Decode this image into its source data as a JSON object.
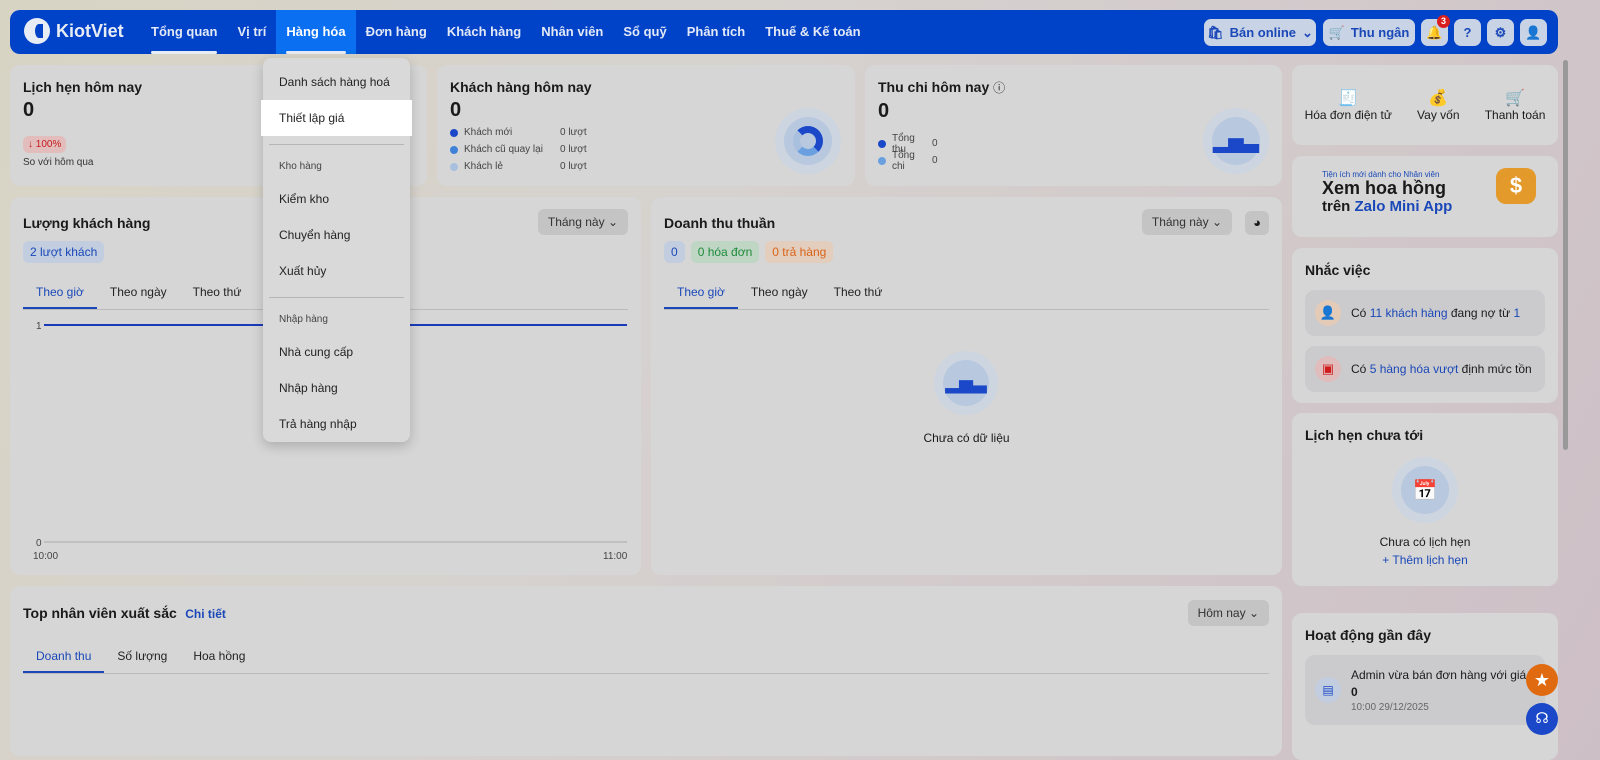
{
  "nav": {
    "brand": "KiotViet",
    "items": [
      "Tổng quan",
      "Vị trí",
      "Hàng hóa",
      "Đơn hàng",
      "Khách hàng",
      "Nhân viên",
      "Sổ quỹ",
      "Phân tích",
      "Thuế & Kế toán"
    ],
    "ban_online": "Bán online",
    "thu_ngan": "Thu ngân",
    "notif_count": "3"
  },
  "dropdown": {
    "items1": [
      "Danh sách hàng hoá",
      "Thiết lập giá"
    ],
    "group2": "Kho hàng",
    "items2": [
      "Kiểm kho",
      "Chuyển hàng",
      "Xuất hủy"
    ],
    "group3": "Nhập hàng",
    "items3": [
      "Nhà cung cấp",
      "Nhập hàng",
      "Trả hàng nhập"
    ]
  },
  "lich_hen": {
    "title": "Lịch hẹn hôm nay",
    "value": "0",
    "change": "↓ 100%",
    "compare": "So với hôm qua"
  },
  "khach_hang": {
    "title": "Khách hàng hôm nay",
    "value": "0",
    "legend": [
      {
        "label": "Khách mới",
        "value": "0 lượt",
        "color": "#1a48c8"
      },
      {
        "label": "Khách cũ quay lại",
        "value": "0 lượt",
        "color": "#3f82d8"
      },
      {
        "label": "Khách lẻ",
        "value": "0 lượt",
        "color": "#a8c0de"
      }
    ]
  },
  "thu_chi": {
    "title": "Thu chi hôm nay",
    "value": "0",
    "legend": [
      {
        "label": "Tổng thu",
        "value": "0",
        "color": "#1a48c8"
      },
      {
        "label": "Tổng chi",
        "value": "0",
        "color": "#6aa0e0"
      }
    ]
  },
  "luong_khach": {
    "title": "Lượng khách hàng",
    "period": "Tháng này",
    "count": "2 lượt khách",
    "tabs": [
      "Theo giờ",
      "Theo ngày",
      "Theo thứ"
    ],
    "chart_data": {
      "type": "line",
      "x": [
        "10:00",
        "11:00"
      ],
      "values": [
        1,
        1
      ],
      "ylim": [
        0,
        1
      ],
      "yticks": [
        "0",
        "1"
      ],
      "xticks": [
        "10:00",
        "11:00"
      ]
    }
  },
  "doanh_thu": {
    "title": "Doanh thu thuần",
    "period": "Tháng này",
    "total": "0",
    "orders": "0 hóa đơn",
    "returns": "0 trả hàng",
    "tabs": [
      "Theo giờ",
      "Theo ngày",
      "Theo thứ"
    ],
    "empty": "Chưa có dữ liệu"
  },
  "top_nv": {
    "title": "Top nhân viên xuất sắc",
    "detail": "Chi tiết",
    "period": "Hôm nay",
    "tabs": [
      "Doanh thu",
      "Số lượng",
      "Hoa hồng"
    ]
  },
  "shortcuts": [
    "Hóa đơn điện tử",
    "Vay vốn",
    "Thanh toán"
  ],
  "banner": {
    "sub": "Tiện ích mới dành cho Nhân viên",
    "line1": "Xem hoa hồng",
    "line2a": "trên ",
    "line2b": "Zalo Mini App"
  },
  "nhac_viec": {
    "title": "Nhắc việc",
    "r1": {
      "a": "Có ",
      "b": "11 khách hàng",
      "c": " đang nợ từ ",
      "d": "1"
    },
    "r2": {
      "a": "Có ",
      "b": "5 hàng hóa vượt",
      "c": " định mức tồn"
    }
  },
  "lich_chua_toi": {
    "title": "Lịch hẹn chưa tới",
    "empty": "Chưa có lịch hẹn",
    "add": "+ Thêm lịch hẹn"
  },
  "hoat_dong": {
    "title": "Hoạt động gần đây",
    "text": "Admin vừa bán đơn hàng với giá trị",
    "value": "0",
    "time": "10:00 29/12/2025"
  }
}
